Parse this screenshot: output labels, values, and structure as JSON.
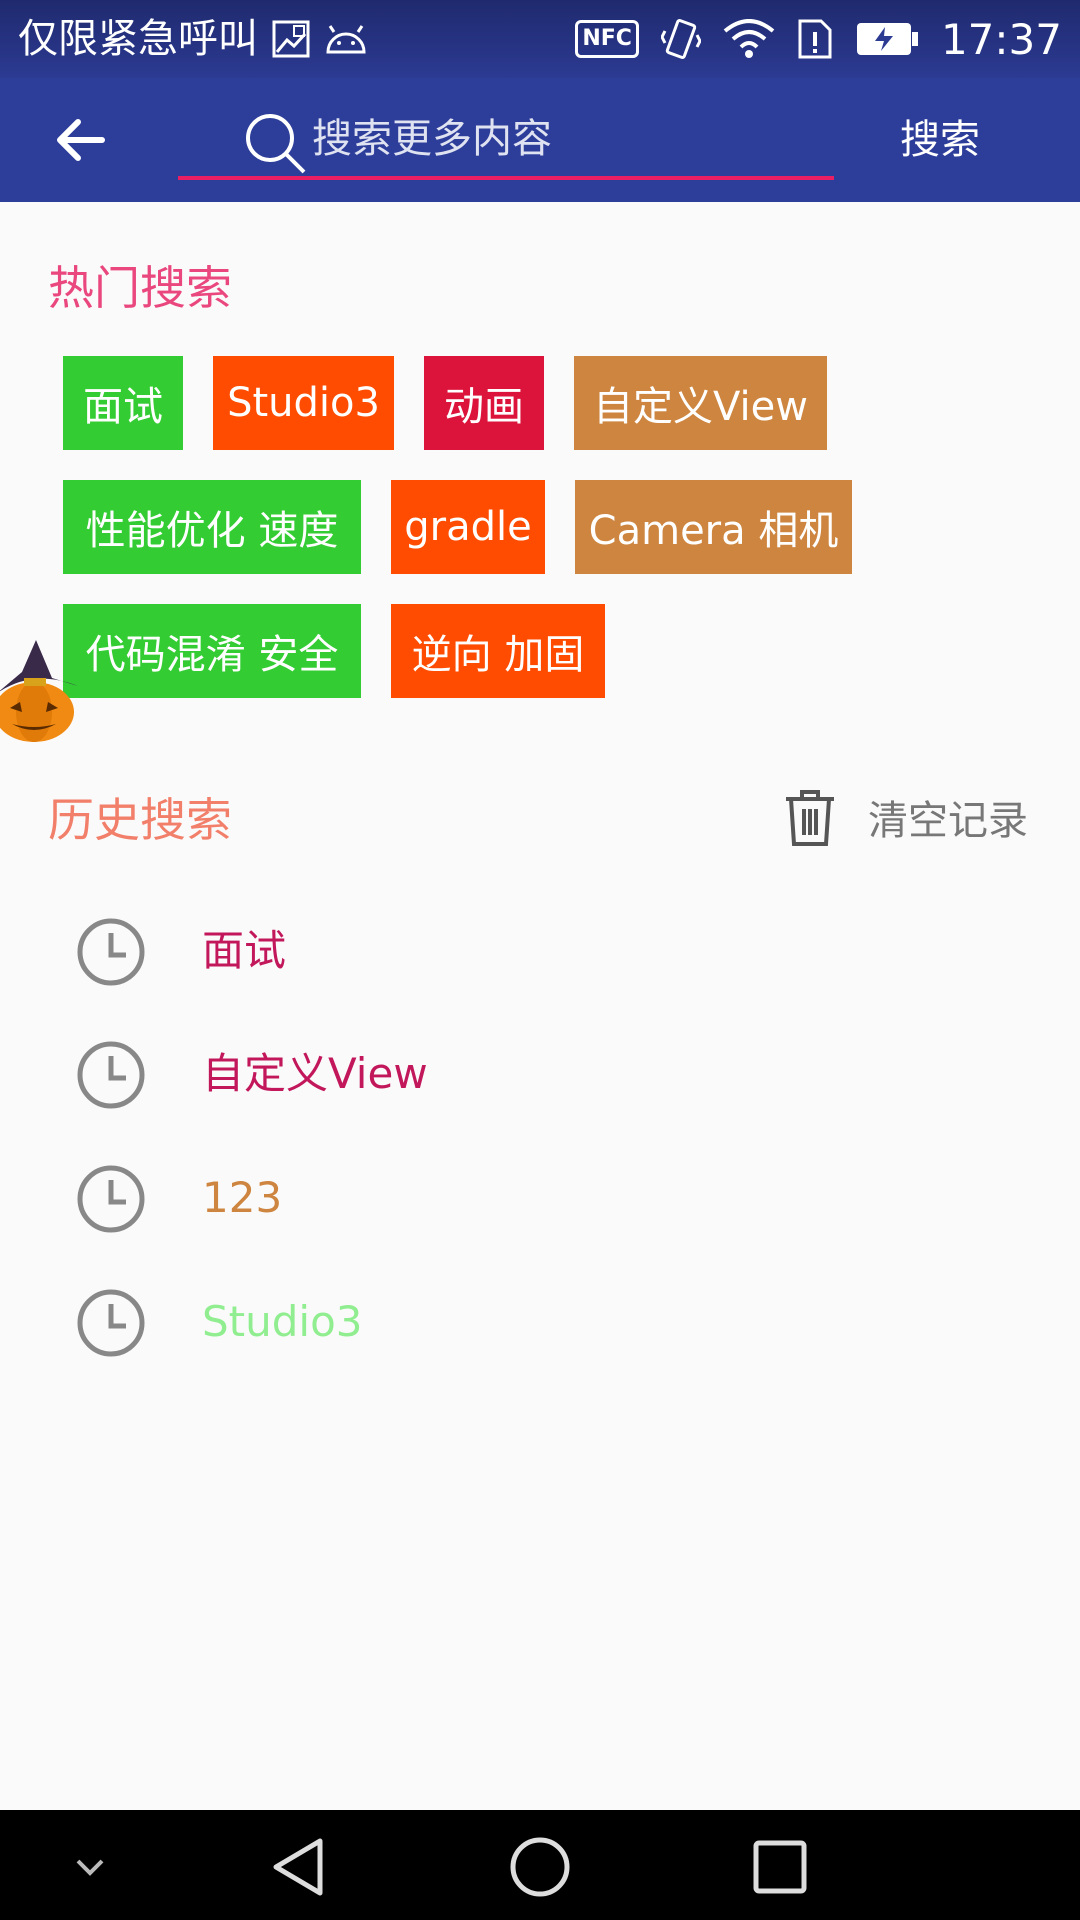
{
  "status_bar": {
    "carrier_text": "仅限紧急呼叫",
    "time": "17:37",
    "icons": [
      "image-icon",
      "android-icon",
      "nfc-icon",
      "vibrate-icon",
      "wifi-icon",
      "sim-alert-icon",
      "battery-charging-icon"
    ],
    "nfc_label": "NFC"
  },
  "toolbar": {
    "back_icon": "arrow-left-icon",
    "search_placeholder": "搜索更多内容",
    "search_value": "",
    "search_button": "搜索",
    "underline_color": "#e91e63",
    "background_color": "#2c3d9a"
  },
  "hot_search": {
    "title": "热门搜索",
    "tags": [
      {
        "label": "面试",
        "color": "#33cc33"
      },
      {
        "label": "Studio3",
        "color": "#ff4c00"
      },
      {
        "label": "动画",
        "color": "#dc143c"
      },
      {
        "label": "自定义View",
        "color": "#cd853f"
      },
      {
        "label": "性能优化 速度",
        "color": "#33cc33"
      },
      {
        "label": "gradle",
        "color": "#ff4c00"
      },
      {
        "label": "Camera 相机",
        "color": "#cd853f"
      },
      {
        "label": "代码混淆 安全",
        "color": "#33cc33"
      },
      {
        "label": "逆向 加固",
        "color": "#ff4c00"
      }
    ]
  },
  "history": {
    "title": "历史搜索",
    "clear_label": "清空记录",
    "clear_icon": "trash-icon",
    "items": [
      {
        "label": "面试",
        "color": "#c2185b"
      },
      {
        "label": "自定义View",
        "color": "#c2185b"
      },
      {
        "label": "123",
        "color": "#cd853f"
      },
      {
        "label": "Studio3",
        "color": "#90ee90"
      }
    ]
  },
  "nav_bar": {
    "buttons": [
      "chevron-down-icon",
      "back-triangle-icon",
      "home-circle-icon",
      "recents-square-icon"
    ]
  },
  "decoration": "pumpkin-icon"
}
